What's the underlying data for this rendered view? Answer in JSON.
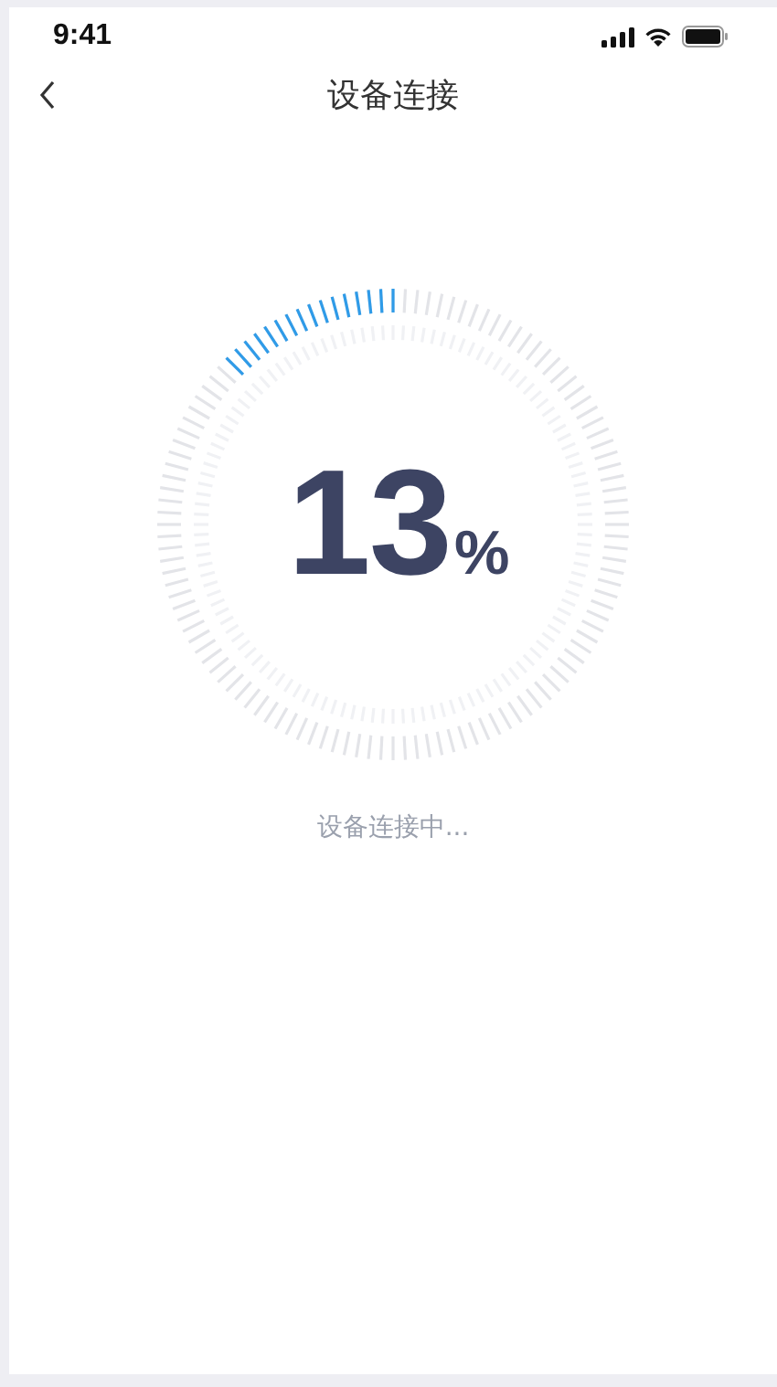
{
  "status_bar": {
    "time": "9:41"
  },
  "nav_bar": {
    "title": "设备连接"
  },
  "progress": {
    "value": "13",
    "unit": "%"
  },
  "status_text": "设备连接中..."
}
